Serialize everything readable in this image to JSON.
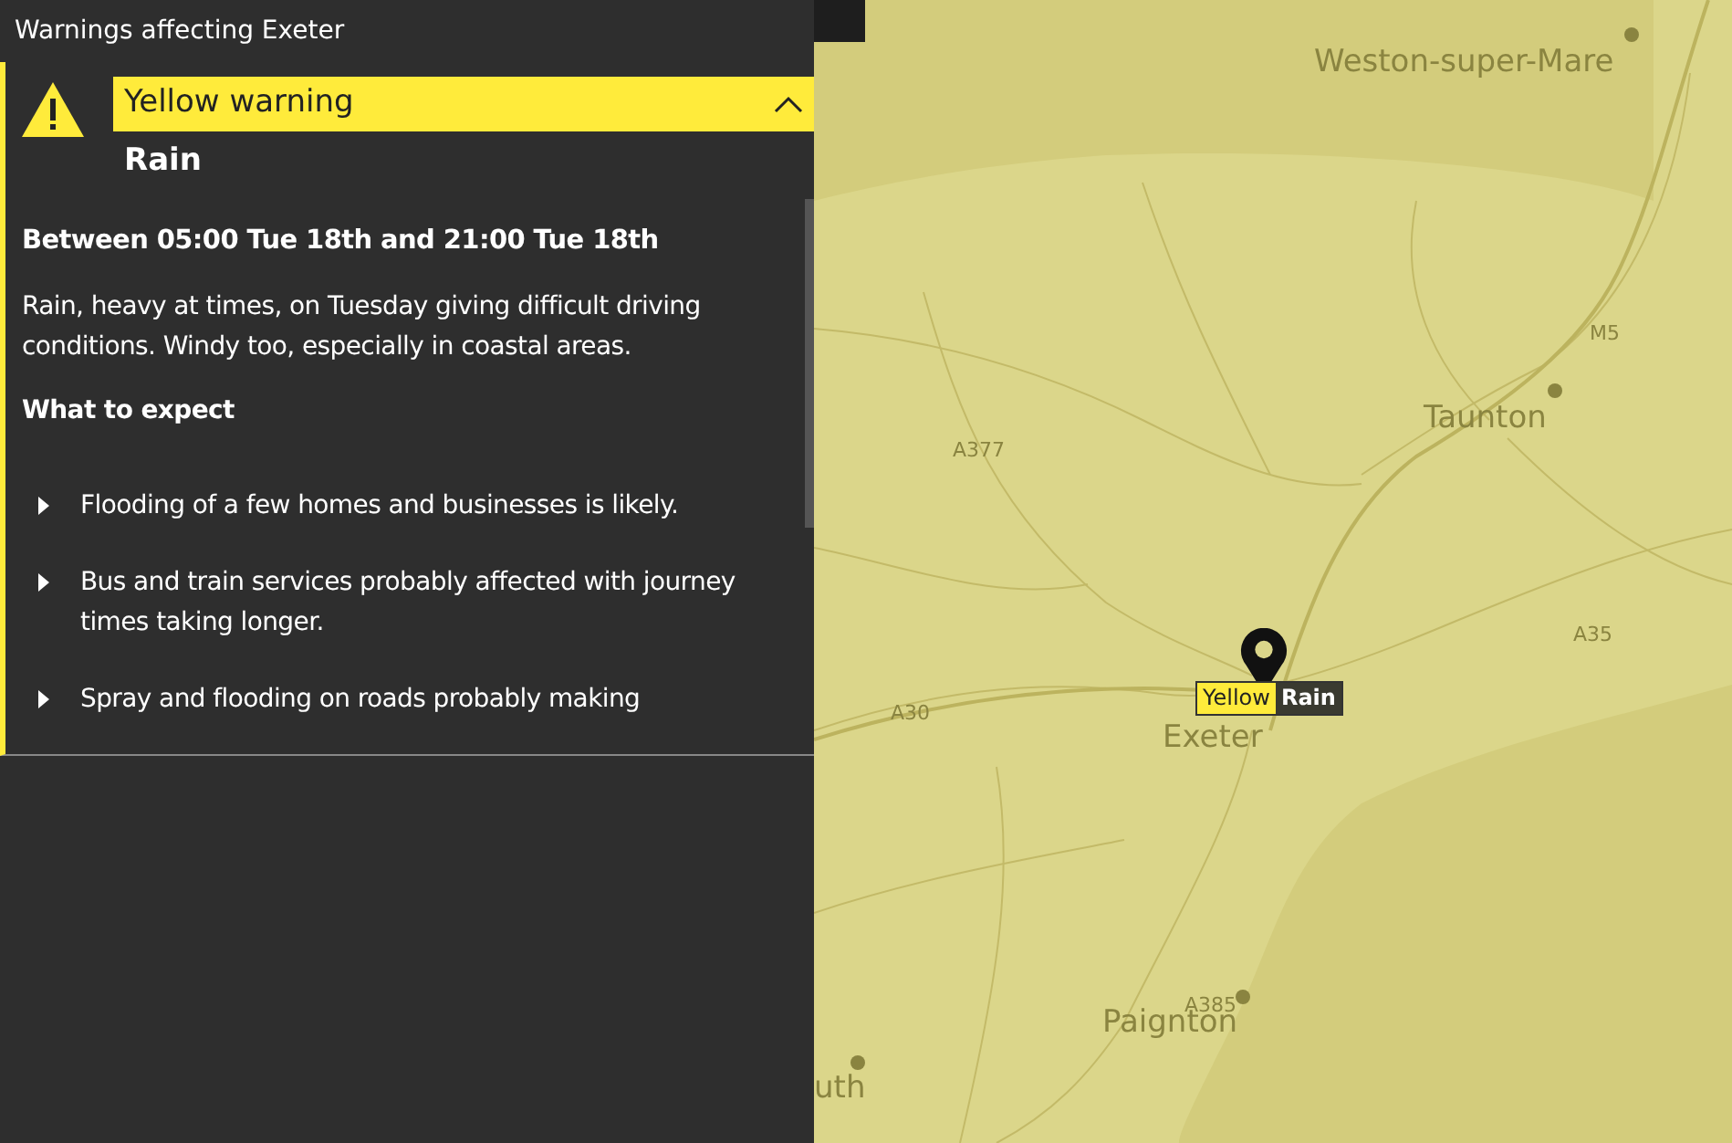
{
  "panel": {
    "title": "Warnings affecting Exeter"
  },
  "warning": {
    "level": "Yellow warning",
    "type": "Rain",
    "expanded": true,
    "period": "Between 05:00 Tue 18th and 21:00 Tue 18th",
    "summary": "Rain, heavy at times, on Tuesday giving difficult driving conditions. Windy too, especially in coastal areas.",
    "expect_heading": "What to expect",
    "impacts": [
      "Flooding of a few homes and businesses is likely.",
      "Bus and train services probably affected with journey times taking longer.",
      "Spray and flooding on roads probably making"
    ]
  },
  "map": {
    "places": [
      {
        "name": "Weston-super-Mare"
      },
      {
        "name": "Taunton"
      },
      {
        "name": "Exeter"
      },
      {
        "name": "Paignton"
      },
      {
        "name": "uth"
      }
    ],
    "roads": [
      "M5",
      "A377",
      "A35",
      "A30",
      "A385"
    ],
    "marker": {
      "level": "Yellow",
      "type": "Rain"
    }
  }
}
